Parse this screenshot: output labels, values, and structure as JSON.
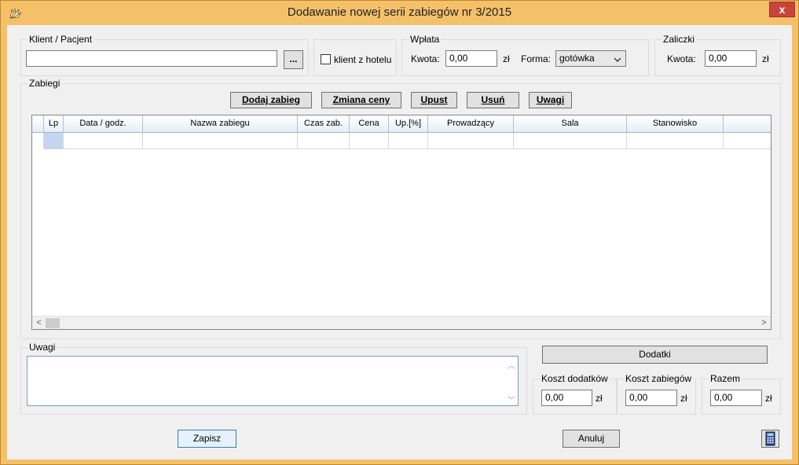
{
  "window": {
    "title": "Dodawanie nowej serii zabiegów nr 3/2015",
    "close_label": "x"
  },
  "client_group": {
    "label": "Klient / Pacjent",
    "value": "",
    "browse_label": "...",
    "hotel_checkbox_label": "klient z hotelu",
    "hotel_checked": false
  },
  "payment_group": {
    "label": "Wpłata",
    "amount_label": "Kwota:",
    "amount_value": "0,00",
    "currency": "zł",
    "form_label": "Forma:",
    "form_value": "gotówka"
  },
  "advance_group": {
    "label": "Zaliczki",
    "amount_label": "Kwota:",
    "amount_value": "0,00",
    "currency": "zł"
  },
  "procedures_group": {
    "label": "Zabiegi",
    "buttons": {
      "add": "Dodaj zabieg",
      "price_change": "Zmiana ceny",
      "discount": "Upust",
      "delete": "Usuń",
      "notes": "Uwagi"
    },
    "columns": [
      "Lp",
      "Data / godz.",
      "Nazwa zabiegu",
      "Czas zab.",
      "Cena",
      "Up.[%]",
      "Prowadzący",
      "Sala",
      "Stanowisko"
    ],
    "rows": [
      [
        "",
        "",
        "",
        "",
        "",
        "",
        "",
        "",
        ""
      ]
    ]
  },
  "notes_group": {
    "label": "Uwagi",
    "value": ""
  },
  "extras_button": "Dodatki",
  "costs": {
    "extras_label": "Koszt dodatków",
    "extras_value": "0,00",
    "procedures_label": "Koszt zabiegów",
    "procedures_value": "0,00",
    "total_label": "Razem",
    "total_value": "0,00",
    "currency": "zł"
  },
  "footer": {
    "save_label": "Zapisz",
    "cancel_label": "Anuluj"
  },
  "icons": {
    "app": "fan-icon",
    "calculator": "calculator-icon"
  },
  "colors": {
    "frame": "#f4c16a",
    "close": "#c7463c",
    "client_bg": "#f0f0f0",
    "grid_header": "#e8eef6",
    "selected_cell": "#c5d5ee"
  }
}
